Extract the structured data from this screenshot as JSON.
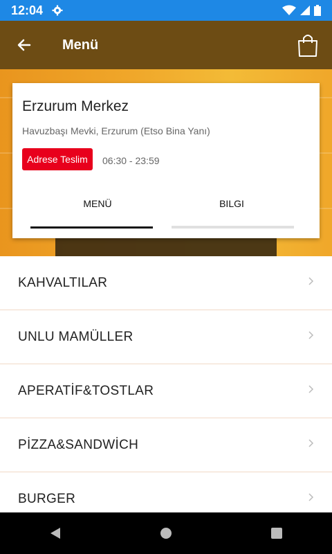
{
  "status_bar": {
    "time": "12:04"
  },
  "app_bar": {
    "title": "Menü"
  },
  "store": {
    "name": "Erzurum Merkez",
    "address": "Havuzbaşı Mevki, Erzurum (Etso Bina Yanı)",
    "badge": "Adrese Teslim",
    "hours": "06:30 - 23:59"
  },
  "tabs": [
    {
      "label": "MENÜ",
      "active": true
    },
    {
      "label": "BILGI",
      "active": false
    }
  ],
  "menu": [
    {
      "label": "KAHVALTILAR"
    },
    {
      "label": "UNLU MAMÜLLER"
    },
    {
      "label": "APERATİF&TOSTLAR"
    },
    {
      "label": "PİZZA&SANDWİCH"
    },
    {
      "label": "BURGER"
    }
  ],
  "colors": {
    "status_bar": "#1e88e5",
    "app_bar": "#6d4c14",
    "badge": "#e8001c"
  }
}
